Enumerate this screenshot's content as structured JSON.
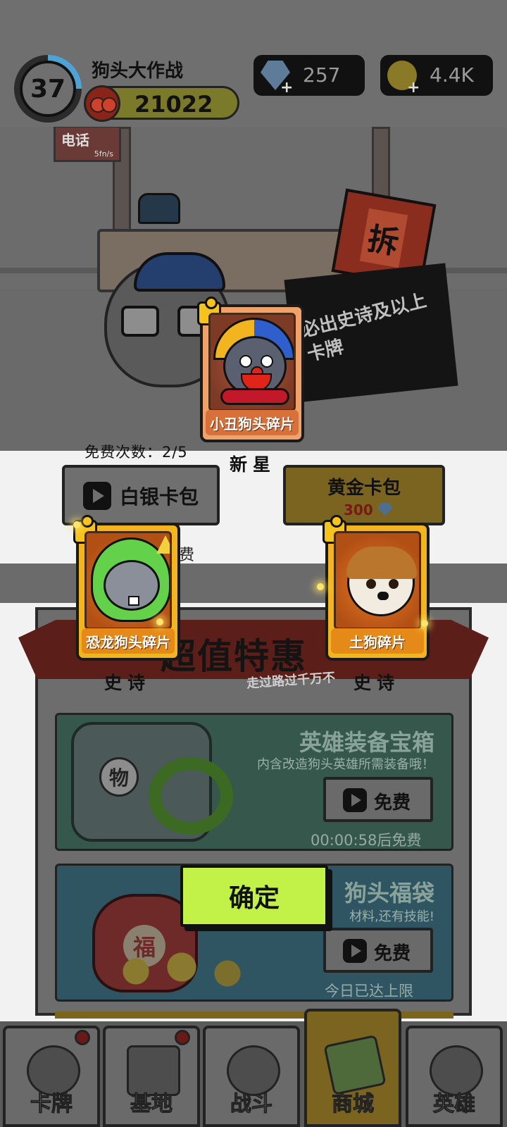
{
  "header": {
    "level": "37",
    "player_name": "狗头大作战",
    "power": "21022",
    "gems": "257",
    "coins": "4.4K"
  },
  "scene": {
    "phone_sign": "电话",
    "phone_sign_sub": "5fn/s",
    "demolish_flag": "拆",
    "banner_text": "必出史诗及以上卡牌"
  },
  "free_count": "免费次数：2/5",
  "packs": {
    "silver_label": "白银卡包",
    "silver_free_suffix": "费",
    "gold_label": "黄金卡包",
    "gold_price": "300"
  },
  "rewards": [
    {
      "name": "小丑狗头碎片",
      "rarity": "新星",
      "frame_color": "#f0a26a"
    },
    {
      "name": "恐龙狗头碎片",
      "rarity": "史诗",
      "frame_color": "#f2b520"
    },
    {
      "name": "土狗碎片",
      "rarity": "史诗",
      "frame_color": "#f2b520"
    }
  ],
  "offers": {
    "title": "超值特惠",
    "subtitle": "走过路过千万不",
    "items": [
      {
        "title": "英雄装备宝箱",
        "desc": "内含改造狗头英雄所需装备哦！",
        "button": "免费",
        "status": "00:00:58后免费",
        "seal": "物"
      },
      {
        "title": "狗头福袋",
        "desc": "材料,还有技能!",
        "button": "免费",
        "status": "今日已达上限",
        "seal": "福"
      }
    ]
  },
  "confirm_label": "确定",
  "nav": [
    {
      "label": "卡牌",
      "icon": "dog-card-icon"
    },
    {
      "label": "基地",
      "icon": "castle-icon"
    },
    {
      "label": "战斗",
      "icon": "paw-icon"
    },
    {
      "label": "商城",
      "icon": "money-icon"
    },
    {
      "label": "英雄",
      "icon": "hero-dog-icon"
    }
  ],
  "colors": {
    "confirm": "#c2f247",
    "card_gold": "#f2b520",
    "card_orange": "#f0a26a",
    "overlay_dim": "#6f6f6f"
  }
}
